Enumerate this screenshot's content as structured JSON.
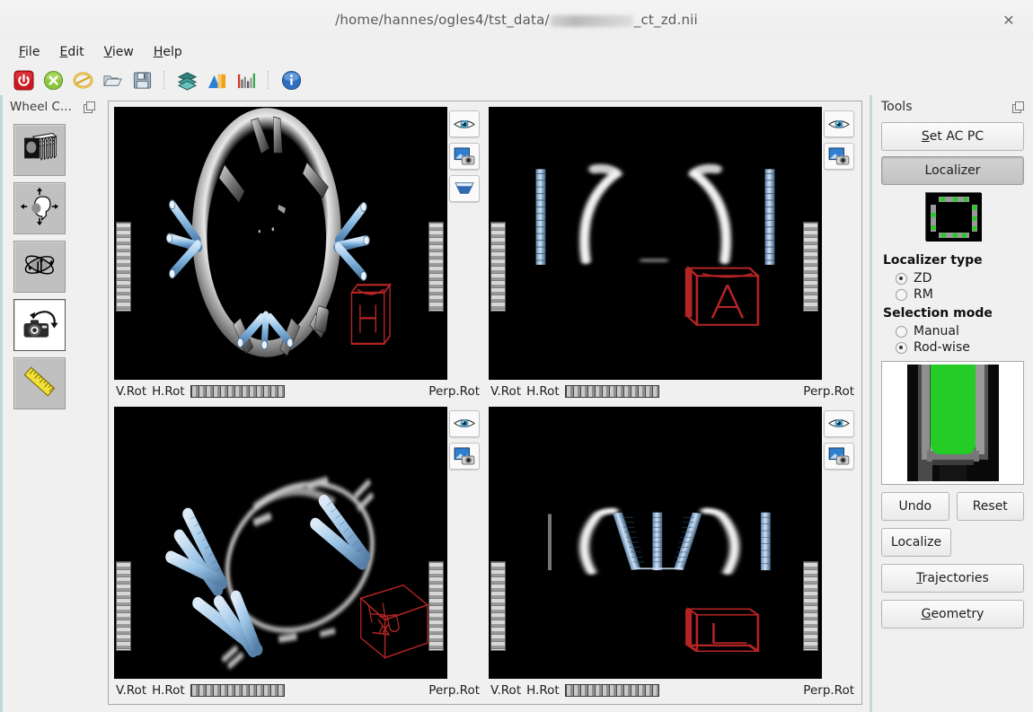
{
  "window": {
    "title_prefix": "/home/hannes/ogles4/tst_data/",
    "title_suffix": "_ct_zd.nii",
    "close_label": "✕"
  },
  "menubar": [
    {
      "label": "File",
      "accel": "F"
    },
    {
      "label": "Edit",
      "accel": "E"
    },
    {
      "label": "View",
      "accel": "V"
    },
    {
      "label": "Help",
      "accel": "H"
    }
  ],
  "toolbar": {
    "items": [
      {
        "name": "power-icon",
        "title": "Quit"
      },
      {
        "name": "close-x-icon",
        "title": "Close"
      },
      {
        "name": "ring-icon",
        "title": "Reset"
      },
      {
        "name": "open-folder-icon",
        "title": "Open"
      },
      {
        "name": "save-floppy-icon",
        "title": "Save"
      },
      {
        "name": "layers-icon",
        "title": "Layers"
      },
      {
        "name": "volume-icon",
        "title": "Volume rendering"
      },
      {
        "name": "histogram-icon",
        "title": "Histogram"
      },
      {
        "name": "info-icon",
        "title": "Info"
      }
    ]
  },
  "leftdock": {
    "header": "Wheel C...",
    "tools": [
      {
        "name": "slices-tool",
        "icon": "slice-stack-icon",
        "active": false
      },
      {
        "name": "translate-tool",
        "icon": "move-arrows-icon",
        "active": false
      },
      {
        "name": "rotate-tool",
        "icon": "orbit-rotate-icon",
        "active": false
      },
      {
        "name": "camera-tool",
        "icon": "camera-rotate-icon",
        "active": true
      },
      {
        "name": "measure-tool",
        "icon": "ruler-icon",
        "active": false
      }
    ]
  },
  "viewports": [
    {
      "id": "vp-3d-axial",
      "labels": {
        "vrot": "V.Rot",
        "hrot": "H.Rot",
        "perp": "Perp.Rot"
      },
      "overlay_buttons": [
        "eye-icon",
        "snapshot-icon",
        "clip-plane-icon"
      ],
      "orientation_cube": "H",
      "cube_style": "flat"
    },
    {
      "id": "vp-slice-coronal",
      "labels": {
        "vrot": "V.Rot",
        "hrot": "H.Rot",
        "perp": "Perp.Rot"
      },
      "overlay_buttons": [
        "eye-icon",
        "snapshot-icon"
      ],
      "orientation_cube": "A",
      "cube_style": "flat"
    },
    {
      "id": "vp-3d-oblique",
      "labels": {
        "vrot": "V.Rot",
        "hrot": "H.Rot",
        "perp": "Perp.Rot"
      },
      "overlay_buttons": [
        "eye-icon",
        "snapshot-icon"
      ],
      "orientation_cube": "HRA",
      "cube_style": "rotated"
    },
    {
      "id": "vp-slice-sagittal",
      "labels": {
        "vrot": "V.Rot",
        "hrot": "H.Rot",
        "perp": "Perp.Rot"
      },
      "overlay_buttons": [
        "eye-icon",
        "snapshot-icon"
      ],
      "orientation_cube": "L",
      "cube_style": "flat"
    }
  ],
  "tools_panel": {
    "header": "Tools",
    "set_ac_pc": "Set AC PC",
    "set_ac_pc_accel": "S",
    "localizer": "Localizer",
    "localizer_type_title": "Localizer type",
    "localizer_types": [
      {
        "label": "ZD",
        "selected": true
      },
      {
        "label": "RM",
        "selected": false
      }
    ],
    "selection_mode_title": "Selection mode",
    "selection_modes": [
      {
        "label": "Manual",
        "selected": false
      },
      {
        "label": "Rod-wise",
        "selected": true
      }
    ],
    "undo": "Undo",
    "reset": "Reset",
    "localize": "Localize",
    "trajectories": "Trajectories",
    "trajectories_accel": "T",
    "geometry": "Geometry",
    "geometry_accel": "G"
  },
  "colors": {
    "accent_dock_edge": "#bfd9d9",
    "panel_bg": "#f0f0f0",
    "canvas_bg": "#000000",
    "orientation_cube": "#b32424",
    "rod_blue": "#a8cbe8",
    "selection_green": "#25cc25"
  }
}
